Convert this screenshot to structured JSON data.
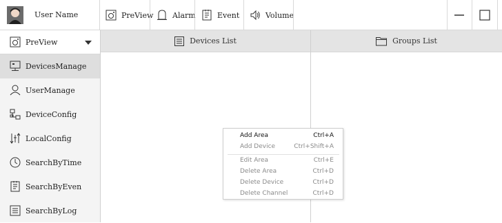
{
  "topbar": {
    "user_name": "User Name",
    "buttons": [
      {
        "label": "PreView",
        "icon": "camera-icon"
      },
      {
        "label": "Alarm",
        "icon": "bell-icon"
      },
      {
        "label": "Event",
        "icon": "event-list-icon"
      },
      {
        "label": "Volume",
        "icon": "speaker-icon"
      }
    ],
    "window_controls": [
      "minimize-icon",
      "maximize-icon"
    ]
  },
  "sidebar": {
    "items": [
      {
        "label": "PreView",
        "icon": "camera-icon"
      },
      {
        "label": "DevicesManage",
        "icon": "monitor-icon"
      },
      {
        "label": "UserManage",
        "icon": "user-icon"
      },
      {
        "label": "DeviceConfig",
        "icon": "network-config-icon"
      },
      {
        "label": "LocalConfig",
        "icon": "sort-arrows-icon"
      },
      {
        "label": "SearchByTime",
        "icon": "clock-icon"
      },
      {
        "label": "SearchByEven",
        "icon": "event-list-icon"
      },
      {
        "label": "SearchByLog",
        "icon": "log-list-icon"
      }
    ],
    "active_index": 1
  },
  "panels": {
    "devices_title": "Devices List",
    "groups_title": "Groups List"
  },
  "context_menu": {
    "items": [
      {
        "label": "Add Area",
        "shortcut": "Ctrl+A",
        "enabled": true
      },
      {
        "label": "Add Device",
        "shortcut": "Ctrl+Shift+A",
        "enabled": false
      },
      {
        "label": "Edit Area",
        "shortcut": "Ctrl+E",
        "enabled": false
      },
      {
        "label": "Delete Area",
        "shortcut": "Ctrl+D",
        "enabled": false
      },
      {
        "label": "Delete Device",
        "shortcut": "Ctrl+D",
        "enabled": false
      },
      {
        "label": "Delete Channel",
        "shortcut": "Ctrl+D",
        "enabled": false
      }
    ]
  },
  "colors": {
    "sidebar_bg": "#f4f4f4",
    "active_item_bg": "#dedede",
    "panel_header_bg": "#e4e4e4",
    "border": "#d8d8d8"
  }
}
